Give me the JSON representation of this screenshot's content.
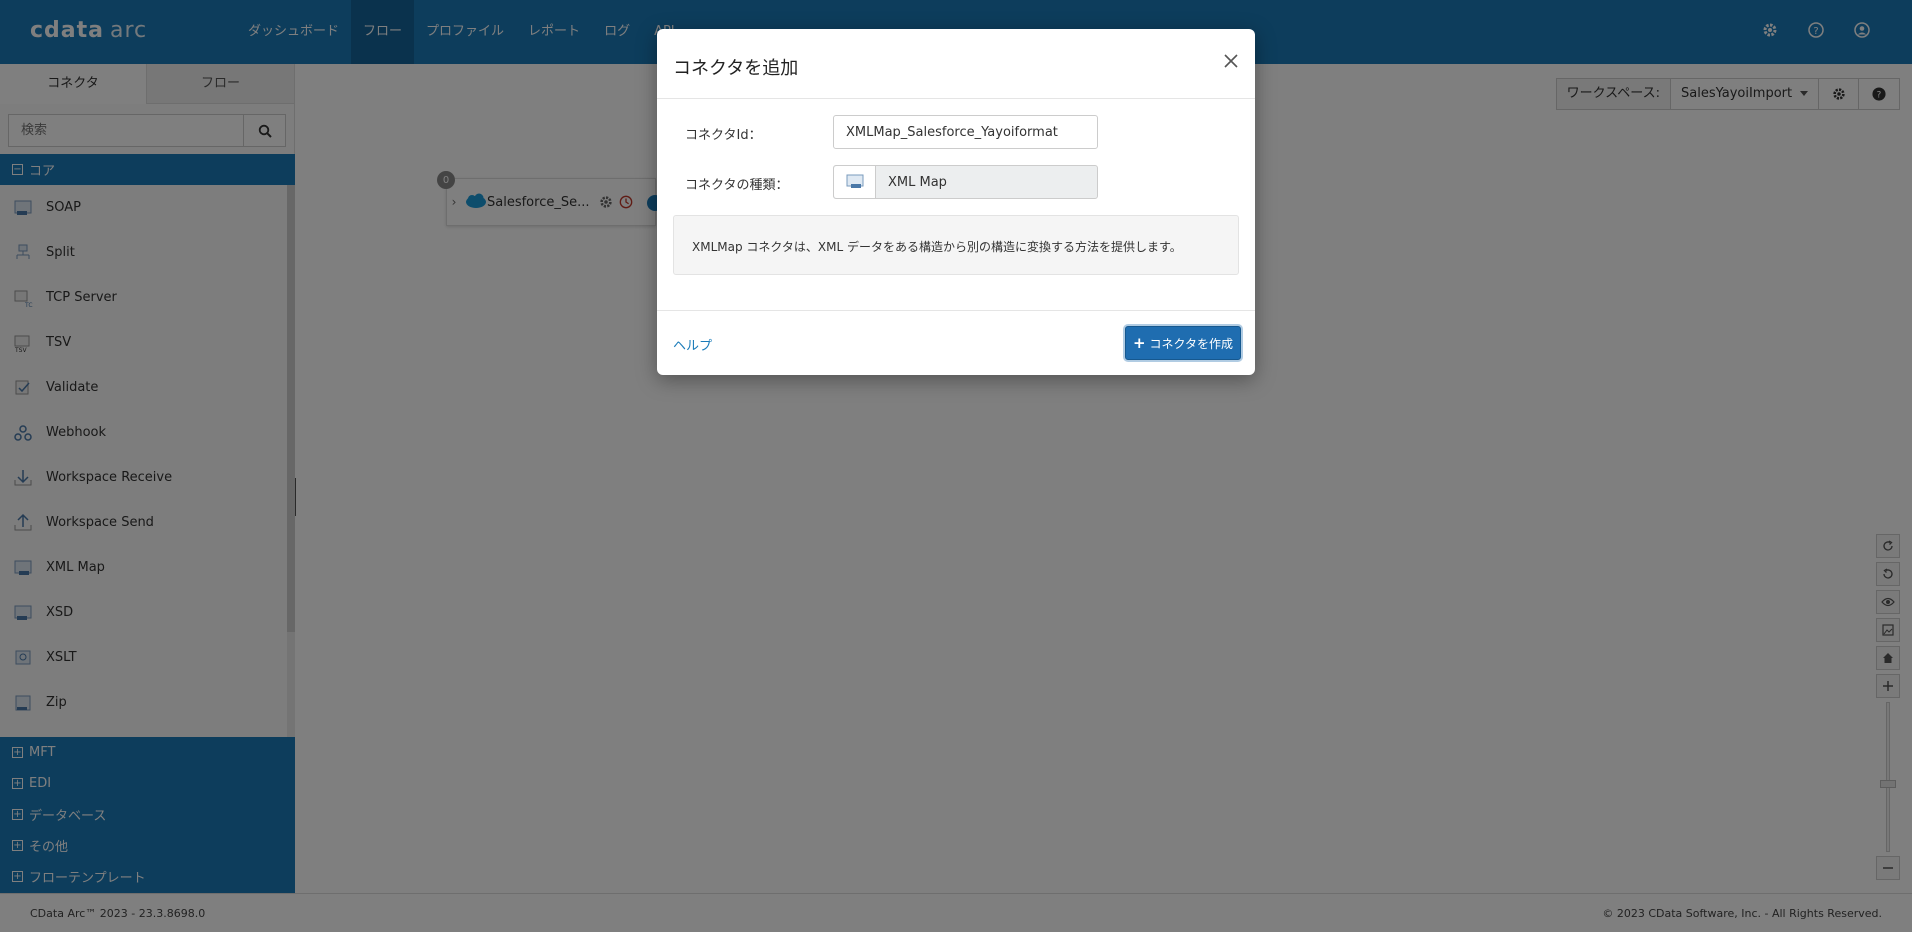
{
  "app": {
    "logo_text": "cdata",
    "logo_suffix": "arc"
  },
  "nav": {
    "items": [
      {
        "label": "ダッシュボード",
        "active": false
      },
      {
        "label": "フロー",
        "active": true
      },
      {
        "label": "プロファイル",
        "active": false
      },
      {
        "label": "レポート",
        "active": false
      },
      {
        "label": "ログ",
        "active": false
      },
      {
        "label": "API",
        "active": false
      }
    ],
    "right_icons": [
      "gear-icon",
      "help-icon",
      "user-icon"
    ]
  },
  "sidebar": {
    "tabs": [
      {
        "label": "コネクタ",
        "active": true
      },
      {
        "label": "フロー",
        "active": false
      }
    ],
    "search_placeholder": "検索",
    "core_section": "コア",
    "connectors": [
      {
        "label": "SOAP"
      },
      {
        "label": "Split"
      },
      {
        "label": "TCP Server"
      },
      {
        "label": "TSV"
      },
      {
        "label": "Validate"
      },
      {
        "label": "Webhook"
      },
      {
        "label": "Workspace Receive"
      },
      {
        "label": "Workspace Send"
      },
      {
        "label": "XML Map"
      },
      {
        "label": "XSD"
      },
      {
        "label": "XSLT"
      },
      {
        "label": "Zip"
      }
    ],
    "sections": [
      {
        "label": "MFT"
      },
      {
        "label": "EDI"
      },
      {
        "label": "データベース"
      },
      {
        "label": "その他"
      },
      {
        "label": "フローテンプレート"
      }
    ]
  },
  "canvas": {
    "workspace_label": "ワークスペース:",
    "workspace_value": "SalesYayoiImport",
    "node": {
      "badge": "0",
      "name": "Salesforce_Se..."
    }
  },
  "footer": {
    "left": "CData Arc™ 2023 - 23.3.8698.0",
    "right": "© 2023 CData Software, Inc. - All Rights Reserved."
  },
  "modal": {
    "title": "コネクタを追加",
    "id_label": "コネクタId：",
    "id_value": "XMLMap_Salesforce_Yayoiformat",
    "type_label": "コネクタの種類：",
    "type_value": "XML Map",
    "description": "XMLMap コネクタは、XML データをある構造から別の構造に変換する方法を提供します。",
    "help_link": "ヘルプ",
    "create_button": "コネクタを作成"
  },
  "colors": {
    "brand": "#1a7bb9",
    "nav_active": "#14659b",
    "primary_button": "#1f6db0"
  }
}
